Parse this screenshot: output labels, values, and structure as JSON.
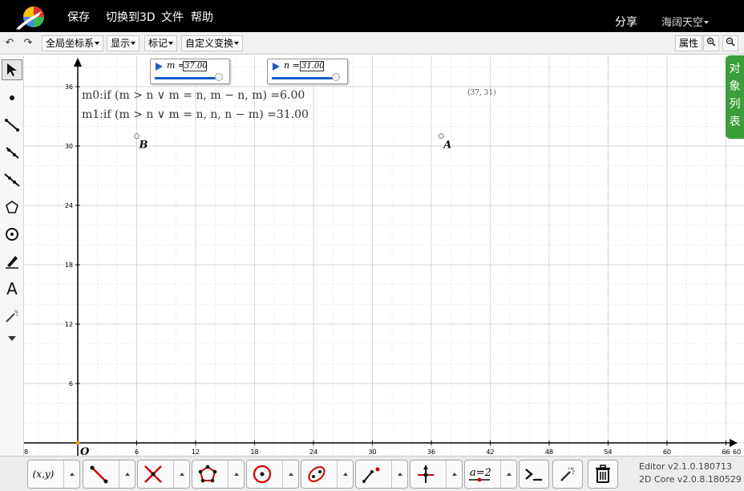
{
  "topbar": {
    "menu": [
      "保存",
      "切换到3D",
      "文件",
      "帮助"
    ],
    "share": "分享",
    "user": "海阔天空"
  },
  "toolbar2": {
    "global_coords": "全局坐标系",
    "display": "显示",
    "mark": "标记",
    "custom_transform": "自定义变换",
    "properties": "属性"
  },
  "sliders": [
    {
      "name": "m",
      "value": "37.00",
      "fraction": 0.95
    },
    {
      "name": "n",
      "value": "31.00",
      "fraction": 0.95
    }
  ],
  "formulas": {
    "m0": "m0:if (m > n ∨ m = n, m − n, m) =6.00",
    "m1": "m1:if (m > n ∨ m = n, n, n − m) =31.00"
  },
  "coord_label": "(37, 31)",
  "points": [
    {
      "name": "B",
      "x": 6,
      "y": 31
    },
    {
      "name": "A",
      "x": 37,
      "y": 31
    }
  ],
  "origin_label": "O",
  "axis": {
    "x_ticks": [
      "6",
      "12",
      "18",
      "24",
      "30",
      "36",
      "42",
      "48",
      "54",
      "60",
      "66"
    ],
    "y_ticks": [
      "6",
      "12",
      "18",
      "24",
      "30",
      "36"
    ],
    "x_first_partial": "8",
    "x_last_partial": "60"
  },
  "right_tab": "对象列表",
  "bottom_tools": {
    "point_coord": "(x,y)",
    "measure": "a=2"
  },
  "version": {
    "editor": "Editor v2.1.0.180713",
    "core": "2D Core v2.0.8.180529"
  },
  "colors": {
    "accent_blue": "#1a5ccc",
    "tab_green": "#3a9e3a",
    "tool_red": "#cc0000"
  }
}
